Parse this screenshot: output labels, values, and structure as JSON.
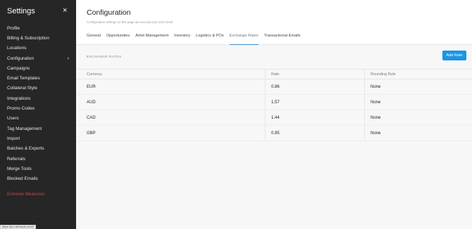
{
  "sidebar": {
    "title": "Settings",
    "close_icon": "×",
    "items": [
      {
        "label": "Profile"
      },
      {
        "label": "Billing & Subscription"
      },
      {
        "label": "Locations"
      },
      {
        "label": "Configuration",
        "chevron": "›",
        "active": true
      },
      {
        "label": "Campaigns"
      },
      {
        "label": "Email Templates"
      },
      {
        "label": "Collateral Style"
      },
      {
        "label": "Integrations"
      },
      {
        "label": "Promo Codes"
      },
      {
        "label": "Users"
      },
      {
        "label": "Tag Management"
      },
      {
        "label": "Import"
      },
      {
        "label": "Batches & Exports"
      },
      {
        "label": "Referrals"
      },
      {
        "label": "Merge Tools"
      },
      {
        "label": "Blocked Emails"
      }
    ],
    "danger_item": {
      "label": "Extreme Measures",
      "color": "#c04a45"
    }
  },
  "statusbar": {
    "url": "https://pro.artcloud.com/#"
  },
  "header": {
    "title": "Configuration",
    "subtitle": "Configuration settings on this page are account (not user) level."
  },
  "tabs": [
    {
      "label": "General"
    },
    {
      "label": "Opportunities"
    },
    {
      "label": "Artist Management"
    },
    {
      "label": "Inventory"
    },
    {
      "label": "Logistics & POs"
    },
    {
      "label": "Exchange Rates",
      "active": true
    },
    {
      "label": "Transactional Emails"
    }
  ],
  "section": {
    "label": "EXCHANGE RATES",
    "add_button": "Add Rate"
  },
  "table": {
    "columns": [
      "Currency",
      "Rate",
      "Rounding Rule"
    ],
    "rows": [
      [
        "EUR",
        "0.86",
        "None"
      ],
      [
        "AUD",
        "1.57",
        "None"
      ],
      [
        "CAD",
        "1.44",
        "None"
      ],
      [
        "GBP",
        "0.95",
        "None"
      ]
    ]
  },
  "colors": {
    "sidebar_bg": "#262626",
    "accent": "#1995e4",
    "danger": "#c04a45"
  }
}
